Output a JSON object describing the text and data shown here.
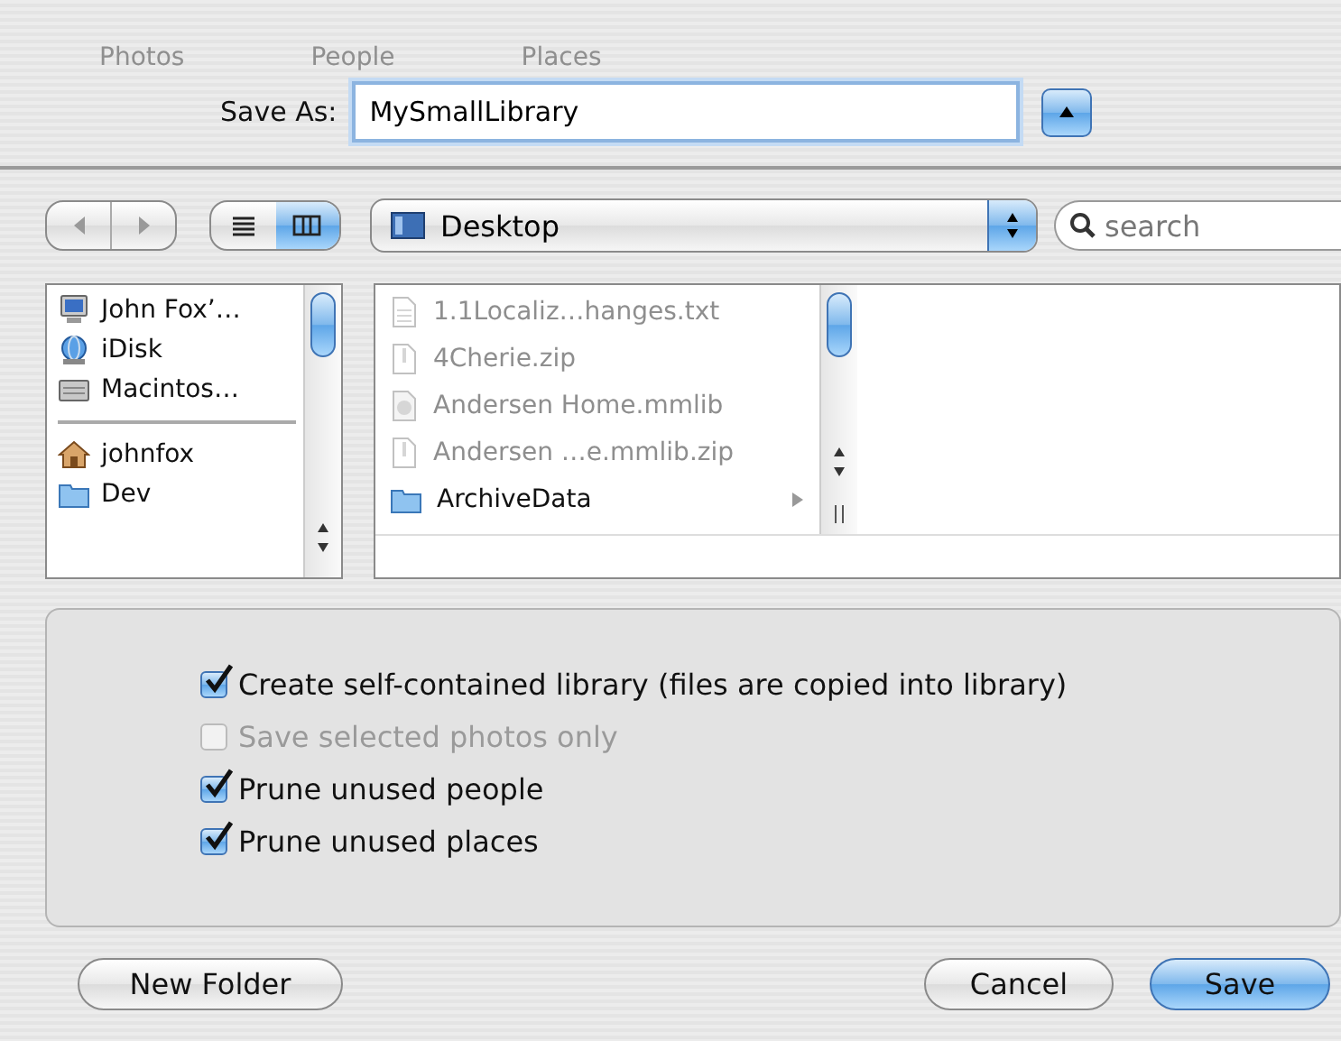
{
  "background_tabs": [
    {
      "label": "Photos"
    },
    {
      "label": "People"
    },
    {
      "label": "Places"
    }
  ],
  "save_as": {
    "label": "Save As:",
    "value": "MySmallLibrary",
    "expanded": true
  },
  "toolbar": {
    "view_modes": [
      {
        "kind": "list",
        "selected": false
      },
      {
        "kind": "columns",
        "selected": true
      }
    ],
    "location": "Desktop",
    "search": {
      "placeholder": "search"
    }
  },
  "sidebar": {
    "sections": [
      {
        "items": [
          {
            "label": "John Fox’…",
            "kind": "computer"
          },
          {
            "label": "iDisk",
            "kind": "idisk"
          },
          {
            "label": "Macintos…",
            "kind": "disk"
          }
        ]
      },
      {
        "items": [
          {
            "label": "johnfox",
            "kind": "home"
          },
          {
            "label": "Dev",
            "kind": "folder"
          }
        ]
      }
    ]
  },
  "columns": [
    {
      "items": [
        {
          "label": "1.1Localiz…hanges.txt",
          "kind": "text",
          "disabled": true
        },
        {
          "label": "4Cherie.zip",
          "kind": "archive",
          "disabled": true
        },
        {
          "label": "Andersen Home.mmlib",
          "kind": "library",
          "disabled": true
        },
        {
          "label": "Andersen …e.mmlib.zip",
          "kind": "archive",
          "disabled": true
        },
        {
          "label": "ArchiveData",
          "kind": "folder",
          "disabled": false
        }
      ]
    }
  ],
  "options": [
    {
      "label": "Create self-contained library (files are copied into library)",
      "checked": true,
      "disabled": false
    },
    {
      "label": "Save selected photos only",
      "checked": false,
      "disabled": true
    },
    {
      "label": "Prune unused people",
      "checked": true,
      "disabled": false
    },
    {
      "label": "Prune unused places",
      "checked": true,
      "disabled": false
    }
  ],
  "buttons": [
    {
      "label": "New Folder",
      "kind": "secondary"
    },
    {
      "label": "Cancel",
      "kind": "normal"
    },
    {
      "label": "Save",
      "kind": "default"
    }
  ]
}
